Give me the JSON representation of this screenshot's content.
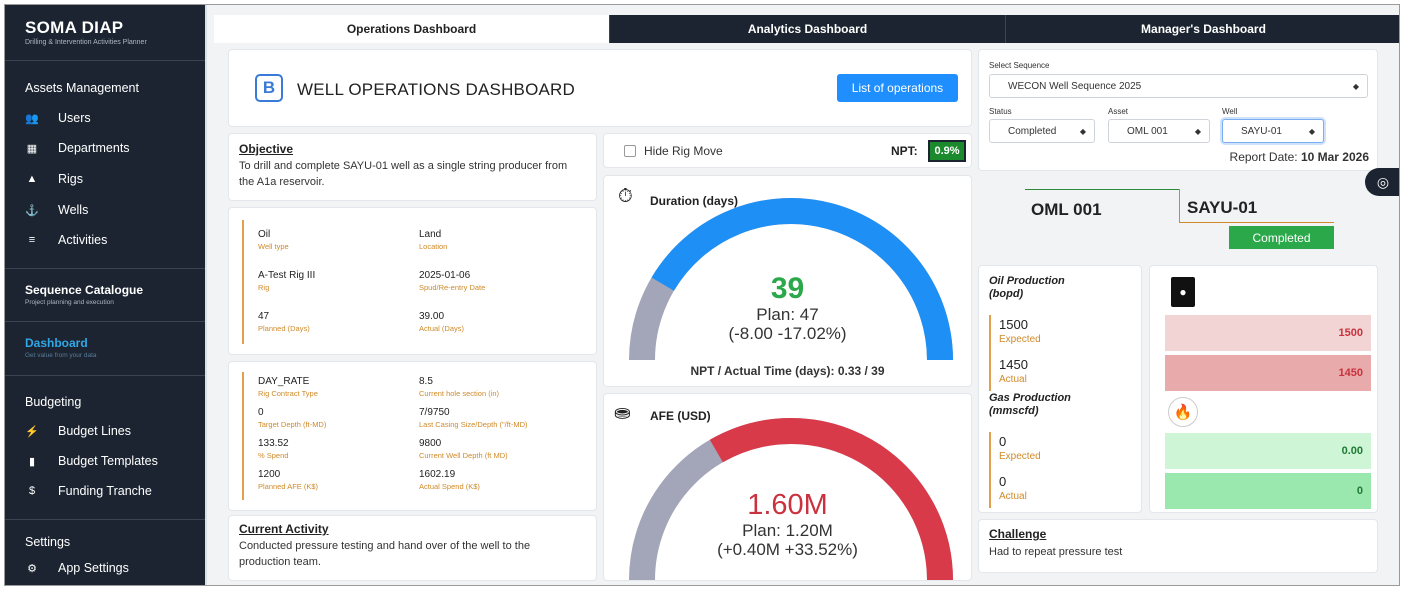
{
  "app": {
    "title": "SOMA DIAP",
    "subtitle": "Drilling & Intervention Activities Planner"
  },
  "sidebar": {
    "assets_title": "Assets Management",
    "assets_items": [
      {
        "label": "Users",
        "icon": "users-icon"
      },
      {
        "label": "Departments",
        "icon": "building-icon"
      },
      {
        "label": "Rigs",
        "icon": "rig-icon"
      },
      {
        "label": "Wells",
        "icon": "anchor-icon"
      },
      {
        "label": "Activities",
        "icon": "list-icon"
      }
    ],
    "sequence_catalogue": {
      "title": "Sequence Catalogue",
      "subtitle": "Project planning and execution"
    },
    "dashboard": {
      "title": "Dashboard",
      "subtitle": "Get value from your data"
    },
    "budgeting_title": "Budgeting",
    "budgeting_items": [
      {
        "label": "Budget Lines",
        "icon": "bolt-icon"
      },
      {
        "label": "Budget Templates",
        "icon": "file-icon"
      },
      {
        "label": "Funding Tranche",
        "icon": "dollar-icon"
      }
    ],
    "settings_title": "Settings",
    "settings_items": [
      {
        "label": "App Settings",
        "icon": "gear-icon"
      }
    ]
  },
  "tabs": [
    "Operations Dashboard",
    "Analytics Dashboard",
    "Manager's Dashboard"
  ],
  "header": {
    "logo_letter": "B",
    "title": "WELL OPERATIONS DASHBOARD",
    "list_button": "List of operations"
  },
  "filters": {
    "sequence_label": "Select Sequence",
    "sequence_value": "WECON Well Sequence 2025",
    "status_label": "Status",
    "status_value": "Completed",
    "asset_label": "Asset",
    "asset_value": "OML 001",
    "well_label": "Well",
    "well_value": "SAYU-01",
    "report_date_label": "Report Date:",
    "report_date_value": "10 Mar 2026"
  },
  "objective": {
    "title": "Objective",
    "text": "To drill and complete SAYU-01 well as a single string producer from the A1a reservoir."
  },
  "well_info": [
    {
      "value": "Oil",
      "label": "Well type"
    },
    {
      "value": "Land",
      "label": "Location"
    },
    {
      "value": "A-Test Rig III",
      "label": "Rig"
    },
    {
      "value": "2025-01-06",
      "label": "Spud/Re-entry Date"
    },
    {
      "value": "47",
      "label": "Planned (Days)"
    },
    {
      "value": "39.00",
      "label": "Actual (Days)"
    }
  ],
  "cost_info": [
    {
      "value": "DAY_RATE",
      "label": "Rig Contract Type"
    },
    {
      "value": "8.5",
      "label": "Current hole section (in)"
    },
    {
      "value": "0",
      "label": "Target Depth (ft-MD)"
    },
    {
      "value": "7/9750",
      "label": "Last Casing Size/Depth (\"/ft-MD)"
    },
    {
      "value": "133.52",
      "label": "% Spend"
    },
    {
      "value": "9800",
      "label": "Current Well Depth (ft MD)"
    },
    {
      "value": "1200",
      "label": "Planned AFE (K$)"
    },
    {
      "value": "1602.19",
      "label": "Actual Spend (K$)"
    }
  ],
  "current_activity": {
    "title": "Current Activity",
    "text": "Conducted pressure testing and hand over of the well to the production team."
  },
  "rig_move": {
    "label": "Hide Rig Move",
    "npt_label": "NPT:",
    "npt_value": "0.9%"
  },
  "duration": {
    "title": "Duration (days)",
    "actual": "39",
    "plan": "Plan: 47",
    "variance": "(-8.00 -17.02%)",
    "footer": "NPT / Actual Time (days): 0.33 / 39",
    "fraction": 0.83,
    "color": "#1e8ff5"
  },
  "afe": {
    "title": "AFE (USD)",
    "actual": "1.60M",
    "plan": "Plan: 1.20M",
    "variance": "(+0.40M +33.52%)",
    "fraction": 0.667,
    "color": "#d93a4a"
  },
  "well_badge": {
    "asset": "OML 001",
    "well": "SAYU-01",
    "status": "Completed"
  },
  "oil": {
    "title": "Oil Production",
    "unit": "(bopd)",
    "expected": "1500",
    "expected_label": "Expected",
    "actual": "1450",
    "actual_label": "Actual",
    "bar_expected": "1500",
    "bar_actual": "1450"
  },
  "gas": {
    "title": "Gas Production",
    "unit": "(mmscfd)",
    "expected": "0",
    "expected_label": "Expected",
    "actual": "0",
    "actual_label": "Actual",
    "bar_expected": "0.00",
    "bar_actual": "0"
  },
  "challenge": {
    "title": "Challenge",
    "text": "Had to repeat pressure test"
  }
}
